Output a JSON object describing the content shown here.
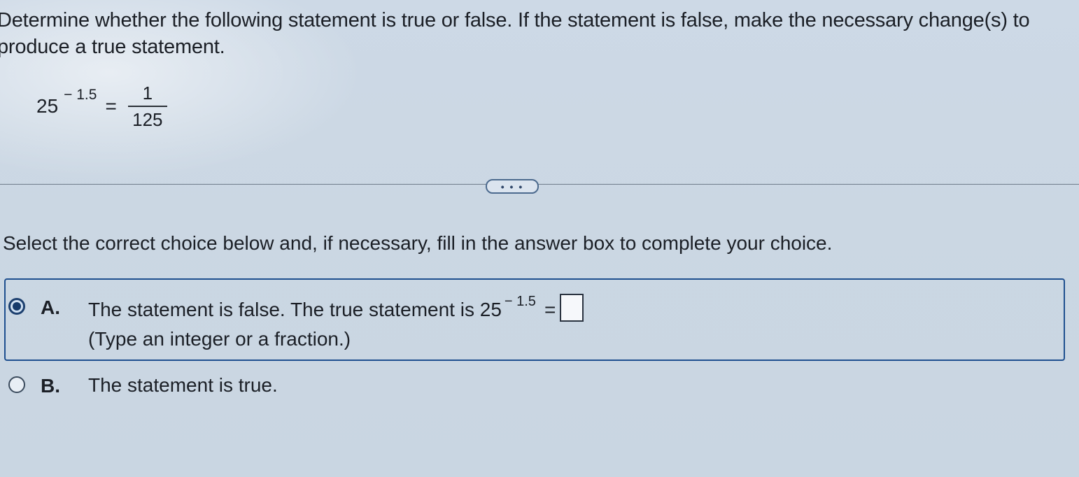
{
  "question": {
    "prompt": "Determine whether the following statement is true or false. If the statement is false, make the necessary change(s) to produce a true statement.",
    "equation": {
      "base": "25",
      "exponent": "− 1.5",
      "equals": "=",
      "numerator": "1",
      "denominator": "125"
    }
  },
  "more_button": {
    "label": "• • •"
  },
  "instruction": "Select the correct choice below and, if necessary, fill in the answer box to complete your choice.",
  "choices": [
    {
      "letter": "A.",
      "text_before": "The statement is false. The true statement is 25",
      "exponent": "− 1.5",
      "equals": "=",
      "hint": "(Type an integer or a fraction.)",
      "selected": true,
      "answer_value": ""
    },
    {
      "letter": "B.",
      "text": "The statement is true.",
      "selected": false
    }
  ],
  "colors": {
    "accent": "#1e4f8f",
    "background": "#cbd7e3",
    "text": "#1b1f26"
  }
}
